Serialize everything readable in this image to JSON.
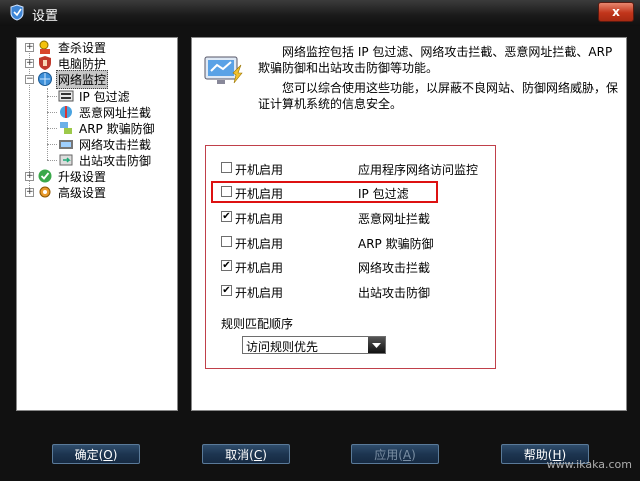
{
  "window": {
    "title": "设置",
    "close_label": "x"
  },
  "tree": {
    "items": [
      {
        "label": "查杀设置",
        "expander": "+",
        "icon": "scan-icon"
      },
      {
        "label": "电脑防护",
        "expander": "+",
        "icon": "shield-hand-icon"
      },
      {
        "label": "网络监控",
        "expander": "−",
        "icon": "network-globe-icon",
        "selected": true
      },
      {
        "label": "IP 包过滤",
        "icon": "ip-filter-icon"
      },
      {
        "label": "恶意网址拦截",
        "icon": "url-block-icon"
      },
      {
        "label": "ARP 欺骗防御",
        "icon": "arp-icon"
      },
      {
        "label": "网络攻击拦截",
        "icon": "attack-block-icon"
      },
      {
        "label": "出站攻击防御",
        "icon": "outbound-icon"
      },
      {
        "label": "升级设置",
        "expander": "+",
        "icon": "upgrade-icon"
      },
      {
        "label": "高级设置",
        "expander": "+",
        "icon": "advanced-gear-icon"
      }
    ]
  },
  "content": {
    "description_1": "网络监控包括 IP 包过滤、网络攻击拦截、恶意网址拦截、ARP 欺骗防御和出站攻击防御等功能。",
    "description_2": "您可以综合使用这些功能，以屏蔽不良网站、防御网络威胁，保证计算机系统的信息安全。",
    "options": [
      {
        "checkbox_label": "开机启用",
        "feature": "应用程序网络访问监控",
        "checked": false
      },
      {
        "checkbox_label": "开机启用",
        "feature": "IP 包过滤",
        "checked": false
      },
      {
        "checkbox_label": "开机启用",
        "feature": "恶意网址拦截",
        "checked": true
      },
      {
        "checkbox_label": "开机启用",
        "feature": "ARP 欺骗防御",
        "checked": false
      },
      {
        "checkbox_label": "开机启用",
        "feature": "网络攻击拦截",
        "checked": true
      },
      {
        "checkbox_label": "开机启用",
        "feature": "出站攻击防御",
        "checked": true
      }
    ],
    "rule_order_label": "规则匹配顺序",
    "rule_order_value": "访问规则优先"
  },
  "buttons": {
    "ok": {
      "text": "确定",
      "key": "O"
    },
    "cancel": {
      "text": "取消",
      "key": "C"
    },
    "apply": {
      "text": "应用",
      "key": "A"
    },
    "help": {
      "text": "帮助",
      "key": "H"
    }
  },
  "watermark": "www.ikaka.com",
  "colors": {
    "highlight": "#dd1111",
    "option_border": "#c0404a"
  }
}
